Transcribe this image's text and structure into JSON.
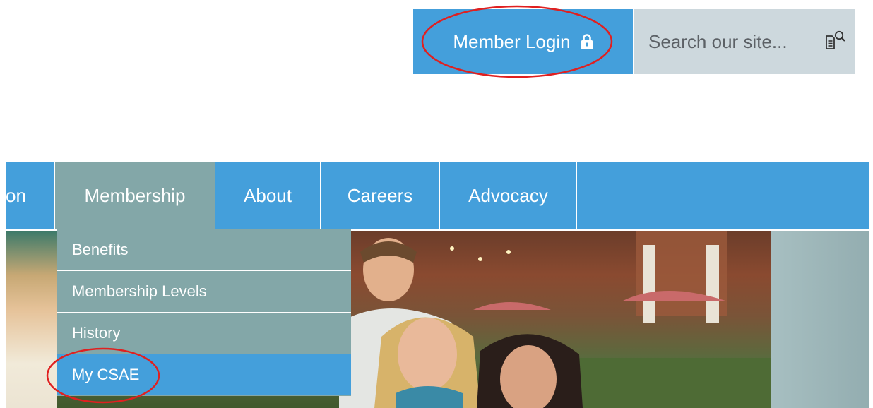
{
  "header": {
    "login_label": "Member Login",
    "search_placeholder": "Search our site..."
  },
  "nav": {
    "items": [
      {
        "label": "on"
      },
      {
        "label": "Membership"
      },
      {
        "label": "About"
      },
      {
        "label": "Careers"
      },
      {
        "label": "Advocacy"
      }
    ]
  },
  "dropdown": {
    "items": [
      {
        "label": "Benefits"
      },
      {
        "label": "Membership Levels"
      },
      {
        "label": "History"
      },
      {
        "label": "My CSAE"
      }
    ]
  },
  "colors": {
    "accent_blue": "#449fdb",
    "menu_gray": "#83a7a8",
    "search_bg": "#cdd8dd",
    "annotation_red": "#e02020"
  },
  "icons": [
    "lock-icon",
    "search-icon"
  ]
}
